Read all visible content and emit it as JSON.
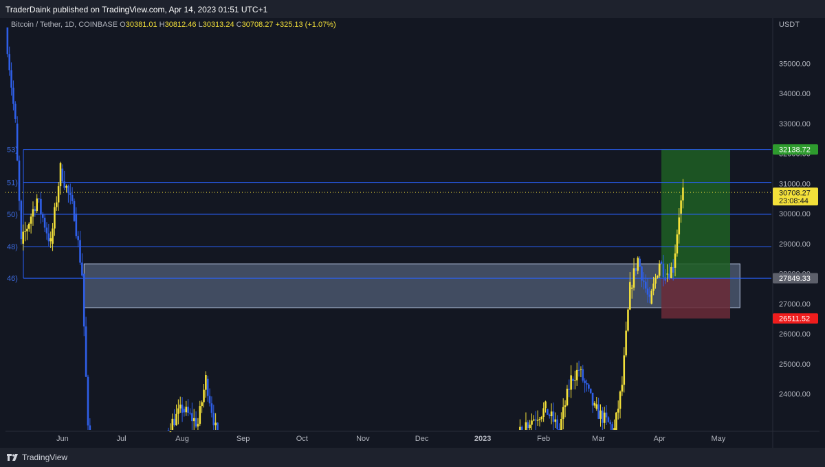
{
  "header": {
    "published": "TraderDaink published on TradingView.com, Apr 14, 2023 01:51 UTC+1"
  },
  "legend": {
    "symbol": "Bitcoin / Tether, 1D, COINBASE",
    "o_label": "O",
    "o_value": "30381.01",
    "h_label": "H",
    "h_value": "30812.46",
    "l_label": "L",
    "l_value": "30313.24",
    "c_label": "C",
    "c_value": "30708.27",
    "change": "+325.13 (+1.07%)"
  },
  "footer": {
    "brand": "TradingView"
  },
  "colors": {
    "background": "#131722",
    "bull": "#f3e03a",
    "bear": "#2f5fe8",
    "fib_line": "#2962ff",
    "target_zone": "#1e5a1f",
    "stop_zone": "#5a2a36",
    "zone_box": "#3a4a66"
  },
  "chart_data": {
    "type": "candlestick",
    "price_unit": "USDT",
    "y_ticks": [
      "35000.00",
      "34000.00",
      "33000.00",
      "32000.00",
      "31000.00",
      "30000.00",
      "29000.00",
      "28000.00",
      "27000.00",
      "26000.00",
      "25000.00",
      "24000.00"
    ],
    "ylim": [
      22800,
      36200
    ],
    "x_ticks": [
      "Jun",
      "Jul",
      "Aug",
      "Sep",
      "Oct",
      "Nov",
      "Dec",
      "2023",
      "Feb",
      "Mar",
      "Apr",
      "May"
    ],
    "x_range": [
      "2022-05-03",
      "2023-05-28"
    ],
    "fib_levels": [
      {
        "label": "53)",
        "price": 32138.72
      },
      {
        "label": "51)",
        "price": 31040
      },
      {
        "label": "50)",
        "price": 29980
      },
      {
        "label": "48)",
        "price": 28900
      },
      {
        "label": "46)",
        "price": 27849.33
      }
    ],
    "price_labels": [
      {
        "text": "32138.72",
        "price": 32138.72,
        "color": "#2e9b2e",
        "text_color": "#ffffff"
      },
      {
        "text": "30708.27",
        "sub": "23:08:44",
        "price": 30708.27,
        "color": "#f3e03a",
        "text_color": "#131722"
      },
      {
        "text": "27849.33",
        "price": 27849.33,
        "color": "#5d606b",
        "text_color": "#ffffff"
      },
      {
        "text": "26511.52",
        "price": 26511.52,
        "color": "#f01d1d",
        "text_color": "#ffffff"
      }
    ],
    "current_price": 30708.27,
    "zone_box": {
      "from": "2022-06-12",
      "to": "2023-05-12",
      "top": 28330,
      "bottom": 26870
    },
    "position": {
      "from": "2023-04-02",
      "to": "2023-05-07",
      "entry": 27849.33,
      "target": 32138.72,
      "stop": 26511.52
    }
  }
}
